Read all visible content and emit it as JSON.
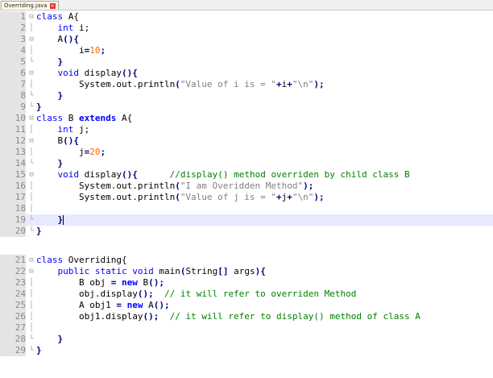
{
  "tab": {
    "title": "Overriding.java"
  },
  "top_pane": [
    {
      "n": "1",
      "fold": "⊟",
      "parts": [
        [
          "kw",
          "class"
        ],
        [
          "t",
          " A{"
        ]
      ]
    },
    {
      "n": "2",
      "fold": "│",
      "parts": [
        [
          "t",
          "    "
        ],
        [
          "kw",
          "int"
        ],
        [
          "t",
          " i;"
        ]
      ]
    },
    {
      "n": "3",
      "fold": "⊟",
      "parts": [
        [
          "t",
          "    A"
        ],
        [
          "op",
          "(){"
        ]
      ]
    },
    {
      "n": "4",
      "fold": "│",
      "parts": [
        [
          "t",
          "        i"
        ],
        [
          "op",
          "="
        ],
        [
          "num",
          "10"
        ],
        [
          "op",
          ";"
        ]
      ]
    },
    {
      "n": "5",
      "fold": "└",
      "parts": [
        [
          "t",
          "    "
        ],
        [
          "op",
          "}"
        ]
      ]
    },
    {
      "n": "6",
      "fold": "⊟",
      "parts": [
        [
          "t",
          "    "
        ],
        [
          "kw",
          "void"
        ],
        [
          "t",
          " display"
        ],
        [
          "op",
          "(){"
        ]
      ]
    },
    {
      "n": "7",
      "fold": "│",
      "parts": [
        [
          "t",
          "        System.out.println"
        ],
        [
          "op",
          "("
        ],
        [
          "str",
          "\"Value of i is = \""
        ],
        [
          "op",
          "+"
        ],
        [
          "t",
          "i"
        ],
        [
          "op",
          "+"
        ],
        [
          "str",
          "\"\\n\""
        ],
        [
          "op",
          ");"
        ]
      ]
    },
    {
      "n": "8",
      "fold": "└",
      "parts": [
        [
          "t",
          "    "
        ],
        [
          "op",
          "}"
        ]
      ]
    },
    {
      "n": "9",
      "fold": "└",
      "parts": [
        [
          "op",
          "}"
        ]
      ]
    },
    {
      "n": "10",
      "fold": "⊟",
      "parts": [
        [
          "kw",
          "class"
        ],
        [
          "t",
          " B "
        ],
        [
          "kwb",
          "extends"
        ],
        [
          "t",
          " A{"
        ]
      ]
    },
    {
      "n": "11",
      "fold": "│",
      "parts": [
        [
          "t",
          "    "
        ],
        [
          "kw",
          "int"
        ],
        [
          "t",
          " j;"
        ]
      ]
    },
    {
      "n": "12",
      "fold": "⊟",
      "parts": [
        [
          "t",
          "    B"
        ],
        [
          "op",
          "(){"
        ]
      ]
    },
    {
      "n": "13",
      "fold": "│",
      "parts": [
        [
          "t",
          "        j"
        ],
        [
          "op",
          "="
        ],
        [
          "num",
          "20"
        ],
        [
          "op",
          ";"
        ]
      ]
    },
    {
      "n": "14",
      "fold": "└",
      "parts": [
        [
          "t",
          "    "
        ],
        [
          "op",
          "}"
        ]
      ]
    },
    {
      "n": "15",
      "fold": "⊟",
      "parts": [
        [
          "t",
          "    "
        ],
        [
          "kw",
          "void"
        ],
        [
          "t",
          " display"
        ],
        [
          "op",
          "(){"
        ],
        [
          "t",
          "      "
        ],
        [
          "cm",
          "//display() method overriden by child class B"
        ]
      ]
    },
    {
      "n": "16",
      "fold": "│",
      "parts": [
        [
          "t",
          "        System.out.println"
        ],
        [
          "op",
          "("
        ],
        [
          "str",
          "\"I am Overidden Method\""
        ],
        [
          "op",
          ");"
        ]
      ]
    },
    {
      "n": "17",
      "fold": "│",
      "parts": [
        [
          "t",
          "        System.out.println"
        ],
        [
          "op",
          "("
        ],
        [
          "str",
          "\"Value of j is = \""
        ],
        [
          "op",
          "+"
        ],
        [
          "t",
          "j"
        ],
        [
          "op",
          "+"
        ],
        [
          "str",
          "\"\\n\""
        ],
        [
          "op",
          ");"
        ]
      ]
    },
    {
      "n": "18",
      "fold": "│",
      "parts": [
        [
          "t",
          ""
        ]
      ]
    },
    {
      "n": "19",
      "fold": "└",
      "parts": [
        [
          "t",
          "    "
        ],
        [
          "op",
          "}"
        ]
      ],
      "current": true
    },
    {
      "n": "20",
      "fold": "└",
      "parts": [
        [
          "op",
          "}"
        ]
      ]
    }
  ],
  "bottom_pane": [
    {
      "n": "21",
      "fold": "⊟",
      "parts": [
        [
          "kw",
          "class"
        ],
        [
          "t",
          " Overriding{"
        ]
      ]
    },
    {
      "n": "22",
      "fold": "⊟",
      "parts": [
        [
          "t",
          "    "
        ],
        [
          "kw",
          "public static void"
        ],
        [
          "t",
          " main"
        ],
        [
          "op",
          "("
        ],
        [
          "t",
          "String"
        ],
        [
          "op",
          "[]"
        ],
        [
          "t",
          " args"
        ],
        [
          "op",
          "){"
        ]
      ]
    },
    {
      "n": "23",
      "fold": "│",
      "parts": [
        [
          "t",
          "        B obj "
        ],
        [
          "op",
          "="
        ],
        [
          "t",
          " "
        ],
        [
          "kwb",
          "new"
        ],
        [
          "t",
          " B"
        ],
        [
          "op",
          "();"
        ]
      ]
    },
    {
      "n": "24",
      "fold": "│",
      "parts": [
        [
          "t",
          "        obj.display"
        ],
        [
          "op",
          "();"
        ],
        [
          "t",
          "  "
        ],
        [
          "cm",
          "// it will refer to overriden Method"
        ]
      ]
    },
    {
      "n": "25",
      "fold": "│",
      "parts": [
        [
          "t",
          "        A obj1 "
        ],
        [
          "op",
          "="
        ],
        [
          "t",
          " "
        ],
        [
          "kwb",
          "new"
        ],
        [
          "t",
          " A"
        ],
        [
          "op",
          "();"
        ]
      ]
    },
    {
      "n": "26",
      "fold": "│",
      "parts": [
        [
          "t",
          "        obj1.display"
        ],
        [
          "op",
          "();"
        ],
        [
          "t",
          "  "
        ],
        [
          "cm",
          "// it will refer to display() method of class A"
        ]
      ]
    },
    {
      "n": "27",
      "fold": "│",
      "parts": [
        [
          "t",
          ""
        ]
      ]
    },
    {
      "n": "28",
      "fold": "└",
      "parts": [
        [
          "t",
          "    "
        ],
        [
          "op",
          "}"
        ]
      ]
    },
    {
      "n": "29",
      "fold": "└",
      "parts": [
        [
          "op",
          "}"
        ]
      ]
    }
  ]
}
